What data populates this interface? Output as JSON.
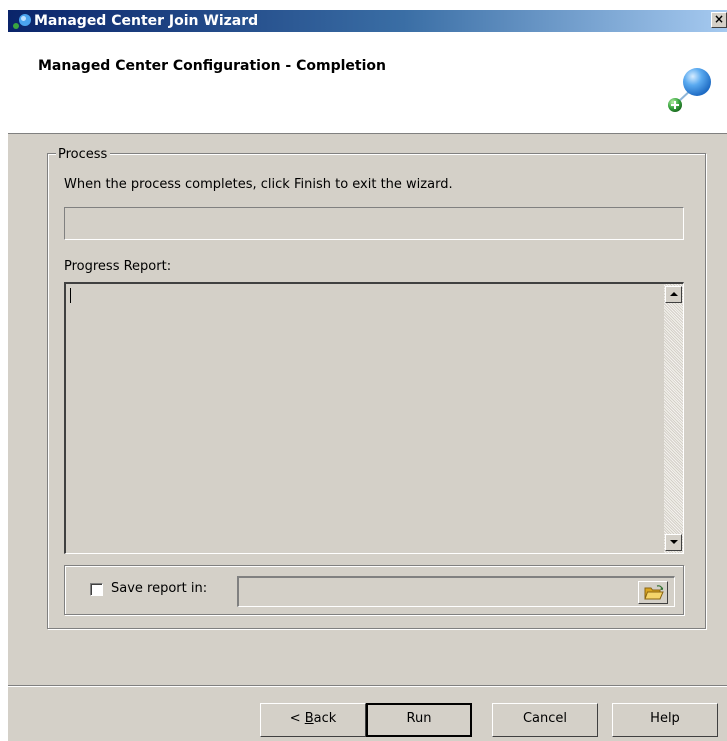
{
  "window": {
    "title": "Managed Center Join Wizard",
    "close_label": "×"
  },
  "header": {
    "title": "Managed Center Configuration - Completion"
  },
  "process": {
    "group_label": "Process",
    "instruction": "When the process completes, click Finish to exit the wizard.",
    "progress_fraction": 0,
    "progress_report_label": "Progress Report:",
    "progress_report_text": ""
  },
  "save_report": {
    "label": "Save report in:",
    "checked": false,
    "path_value": ""
  },
  "buttons": {
    "back_prefix": "< ",
    "back_mnemonic": "B",
    "back_suffix": "ack",
    "run": "Run",
    "cancel": "Cancel",
    "help": "Help"
  },
  "colors": {
    "title_bar_start": "#0a246a",
    "title_bar_end": "#a6caf0",
    "dialog_face": "#d4d0c8",
    "header_background": "#ffffff"
  },
  "icons": {
    "app": "wizard-app-icon",
    "header": "wizard-header-icon",
    "browse": "folder-open-icon",
    "scroll_up": "arrow-up-icon",
    "scroll_down": "arrow-down-icon"
  }
}
